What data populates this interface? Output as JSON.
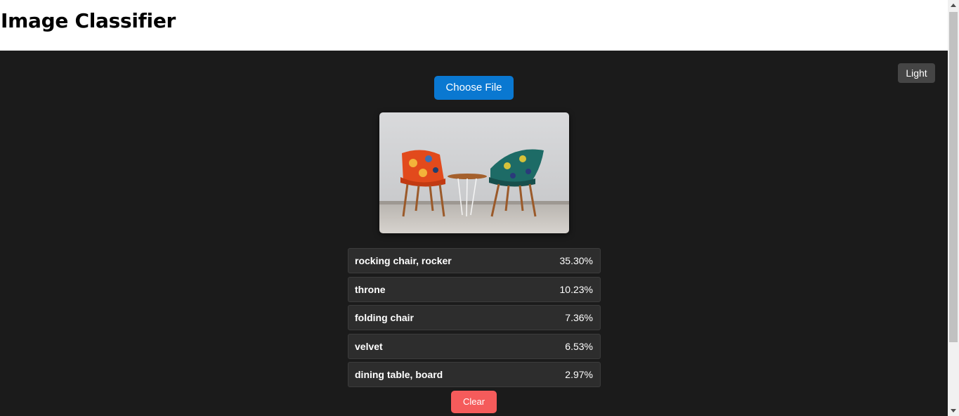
{
  "header": {
    "title": "Image Classifier"
  },
  "theme_toggle": {
    "label": "Light"
  },
  "upload": {
    "choose_label": "Choose File"
  },
  "preview": {
    "icon": "image-preview"
  },
  "results": [
    {
      "label": "rocking chair, rocker",
      "percent": "35.30%"
    },
    {
      "label": "throne",
      "percent": "10.23%"
    },
    {
      "label": "folding chair",
      "percent": "7.36%"
    },
    {
      "label": "velvet",
      "percent": "6.53%"
    },
    {
      "label": "dining table, board",
      "percent": "2.97%"
    }
  ],
  "actions": {
    "clear_label": "Clear"
  },
  "colors": {
    "primary": "#0a78d1",
    "danger": "#f55b5b",
    "background": "#1b1b1b",
    "row": "#2d2d2d"
  }
}
